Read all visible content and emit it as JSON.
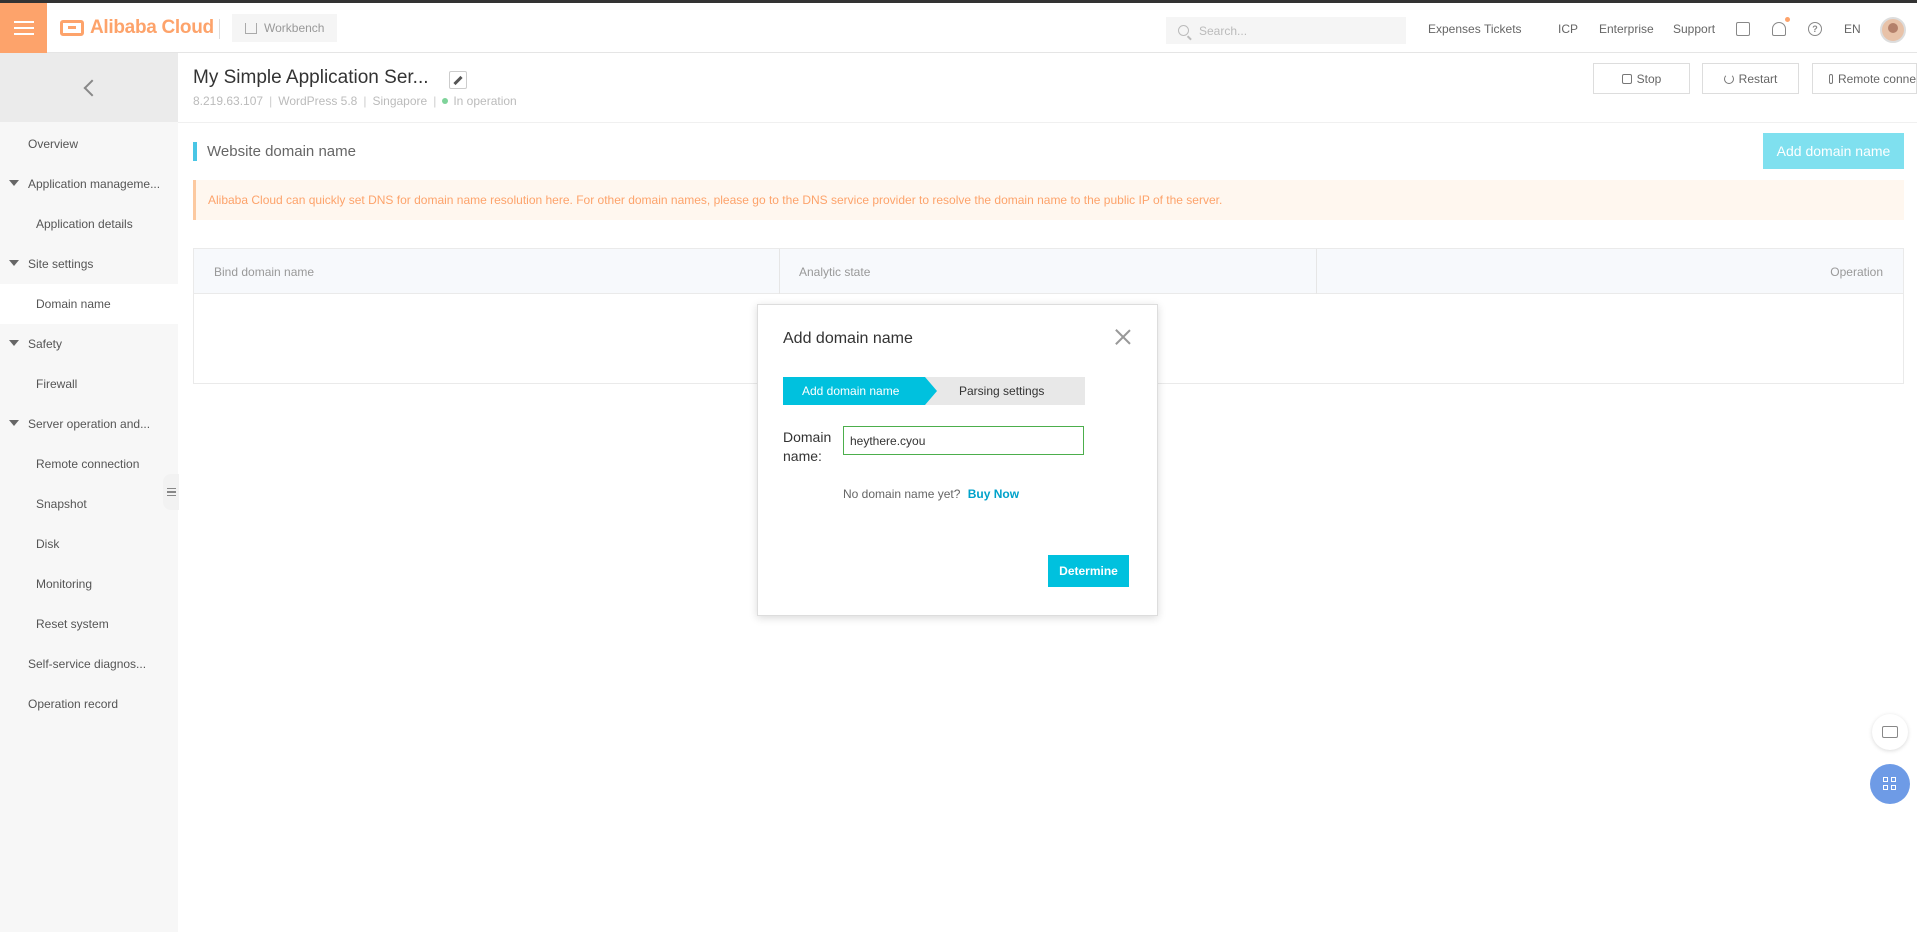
{
  "topbar": {
    "brand": "Alibaba Cloud",
    "workbench": "Workbench",
    "search_placeholder": "Search...",
    "links": [
      "Expenses",
      "Tickets",
      "ICP",
      "Enterprise",
      "Support"
    ],
    "language": "EN",
    "icons": [
      "hamburger-icon",
      "home-icon",
      "search-icon",
      "terminal-icon",
      "bell-icon",
      "help-icon"
    ]
  },
  "sidebar": {
    "items": [
      {
        "label": "Overview"
      },
      {
        "label": "Application manageme..."
      },
      {
        "label": "Application details"
      },
      {
        "label": "Site settings"
      },
      {
        "label": "Domain name"
      },
      {
        "label": "Safety"
      },
      {
        "label": "Firewall"
      },
      {
        "label": "Server operation and..."
      },
      {
        "label": "Remote connection"
      },
      {
        "label": "Snapshot"
      },
      {
        "label": "Disk"
      },
      {
        "label": "Monitoring"
      },
      {
        "label": "Reset system"
      },
      {
        "label": "Self-service diagnos..."
      },
      {
        "label": "Operation record"
      }
    ]
  },
  "server": {
    "title": "My Simple Application Ser...",
    "ip": "8.219.63.107",
    "app": "WordPress 5.8",
    "region": "Singapore",
    "status": "In operation",
    "actions": {
      "stop": "Stop",
      "restart": "Restart",
      "remote": "Remote conne"
    }
  },
  "main": {
    "section_title": "Website domain name",
    "add_button": "Add domain name",
    "notice": "Alibaba Cloud can quickly set DNS for domain name resolution here. For other domain names, please go to the DNS service provider to resolve the domain name to the public IP of the server.",
    "table_headers": [
      "Bind domain name",
      "Analytic state",
      "Operation"
    ]
  },
  "modal": {
    "title": "Add domain name",
    "steps": [
      "Add domain name",
      "Parsing settings"
    ],
    "field_label": "Domain name:",
    "field_value": "heythere.cyou",
    "no_domain_text": "No domain name yet?",
    "buy_now": "Buy Now",
    "confirm_button": "Determine"
  },
  "colors": {
    "accent": "#00c1de",
    "brand_orange": "#fda36b",
    "add_button_bg": "#7fe0ef",
    "status_green": "#7fd39a",
    "notice_text": "#fda36b"
  }
}
